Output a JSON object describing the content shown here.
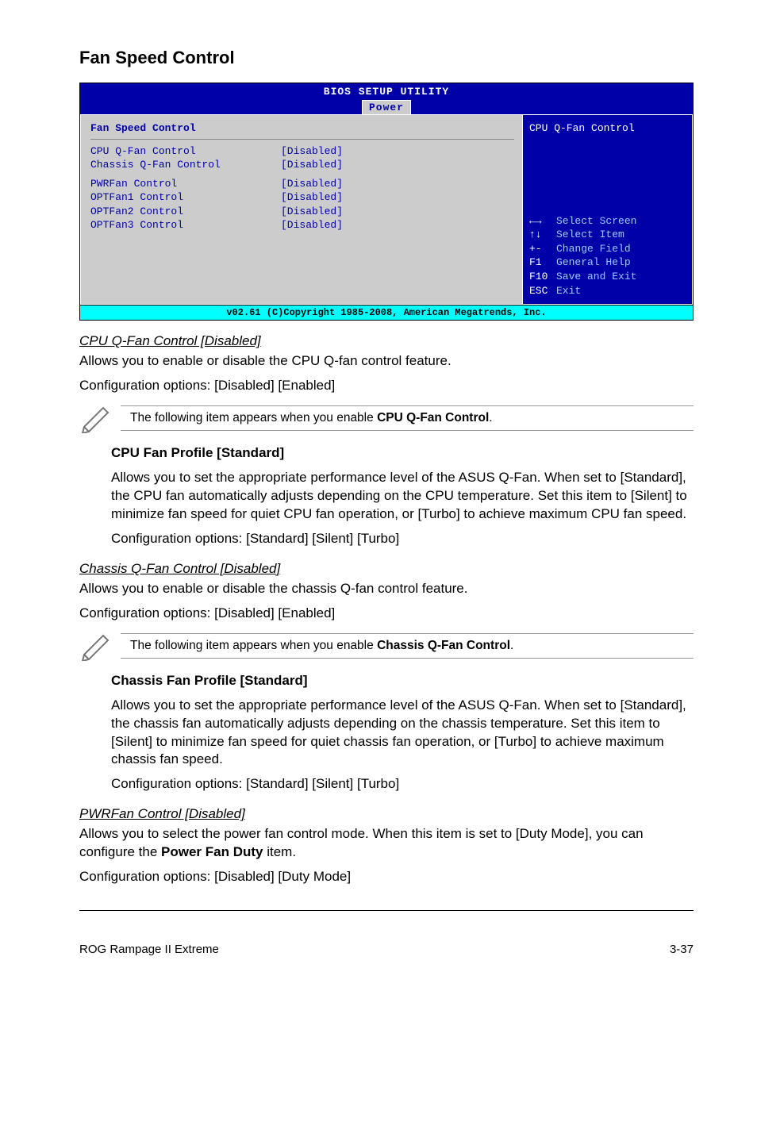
{
  "title": "Fan Speed Control",
  "bios": {
    "header": "BIOS SETUP UTILITY",
    "tab": "Power",
    "sectionTitle": "Fan Speed Control",
    "rows1": [
      {
        "k": "CPU Q-Fan Control",
        "v": "[Disabled]"
      },
      {
        "k": "Chassis Q-Fan Control",
        "v": "[Disabled]"
      }
    ],
    "rows2": [
      {
        "k": "PWRFan Control",
        "v": "[Disabled]"
      },
      {
        "k": "OPTFan1 Control",
        "v": "[Disabled]"
      },
      {
        "k": "OPTFan2 Control",
        "v": "[Disabled]"
      },
      {
        "k": "OPTFan3 Control",
        "v": "[Disabled]"
      }
    ],
    "sideHelp": "CPU Q-Fan Control",
    "nav": [
      {
        "sym": "←→",
        "label": "Select Screen"
      },
      {
        "sym": "↑↓",
        "label": "Select Item"
      },
      {
        "sym": "+-",
        "label": "Change Field"
      },
      {
        "sym": "F1",
        "label": "General Help"
      },
      {
        "sym": "F10",
        "label": "Save and Exit"
      },
      {
        "sym": "ESC",
        "label": "Exit"
      }
    ],
    "footer": "v02.61 (C)Copyright 1985-2008, American Megatrends, Inc."
  },
  "sec1": {
    "heading": "CPU Q-Fan Control [Disabled]",
    "p1": "Allows you to enable or disable the CPU Q-fan control feature.",
    "p2": "Configuration options: [Disabled] [Enabled]",
    "noteA": "The following item appears when you enable ",
    "noteB": "CPU Q-Fan Control",
    "noteC": ".",
    "sub": "CPU Fan Profile [Standard]",
    "subp": "Allows you to set the appropriate performance level of the ASUS Q-Fan. When set to [Standard], the CPU fan automatically adjusts depending on the CPU temperature. Set this item to [Silent] to minimize fan speed for quiet CPU fan operation, or [Turbo] to achieve maximum CPU fan speed.",
    "subp2": "Configuration options: [Standard] [Silent] [Turbo]"
  },
  "sec2": {
    "heading": "Chassis Q-Fan Control [Disabled]",
    "p1": "Allows you to enable or disable the chassis Q-fan control feature.",
    "p2": "Configuration options: [Disabled] [Enabled]",
    "noteA": "The following item appears when you enable ",
    "noteB": "Chassis Q-Fan Control",
    "noteC": ".",
    "sub": "Chassis Fan Profile [Standard]",
    "subp": "Allows you to set the appropriate performance level of the ASUS Q-Fan. When set to [Standard], the chassis fan automatically adjusts depending on the chassis temperature. Set this item to [Silent] to minimize fan speed for quiet chassis fan operation, or [Turbo] to achieve maximum chassis fan speed.",
    "subp2": "Configuration options: [Standard] [Silent] [Turbo]"
  },
  "sec3": {
    "heading": "PWRFan Control [Disabled]",
    "p1a": "Allows you to select the power fan control mode. When this item is set to [Duty Mode], you can configure the ",
    "p1b": "Power Fan Duty",
    "p1c": " item.",
    "p2": "Configuration options: [Disabled] [Duty Mode]"
  },
  "footer": {
    "left": "ROG Rampage II Extreme",
    "right": "3-37"
  }
}
